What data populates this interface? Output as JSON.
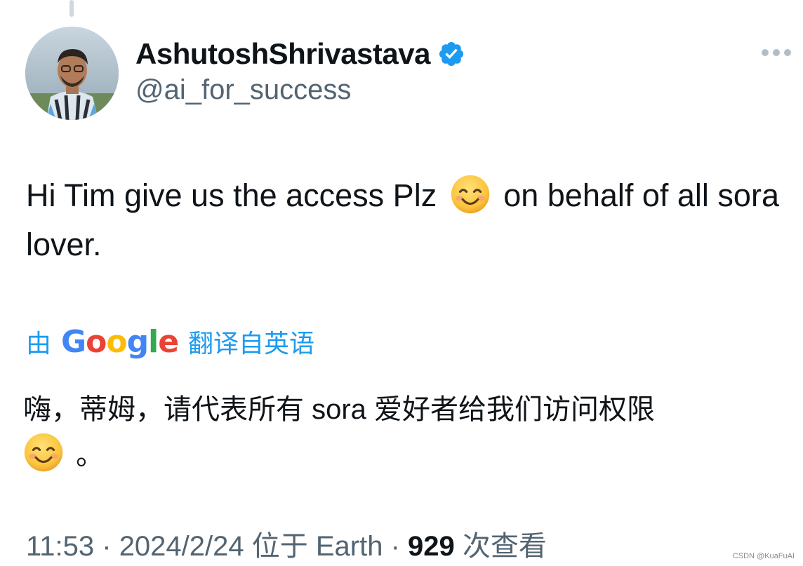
{
  "tweet": {
    "author": {
      "display_name": "AshutoshShrivastava",
      "handle": "@ai_for_success",
      "verified": true
    },
    "text_before_emoji": "Hi Tim give us the access Plz ",
    "text_after_emoji": " on behalf of all sora lover.",
    "translate_prefix": "由",
    "translate_brand": "Google",
    "translate_suffix": "翻译自英语",
    "translated_text": "嗨，蒂姆，请代表所有 sora 爱好者给我们访问权限",
    "translated_text_end": " 。",
    "meta": {
      "time": "11:53",
      "separator": " · ",
      "date": "2024/2/24",
      "location": " 位于 Earth",
      "views_count": "929",
      "views_label": " 次查看"
    }
  },
  "watermark": "CSDN @KuaFuAI",
  "colors": {
    "link_blue": "#1d9bf0",
    "secondary_text": "#536471",
    "verified_badge": "#1d9bf0"
  },
  "icons": {
    "more": "more-horizontal-icon",
    "verified": "verified-badge-icon",
    "emoji": "smiling-face-emoji"
  }
}
